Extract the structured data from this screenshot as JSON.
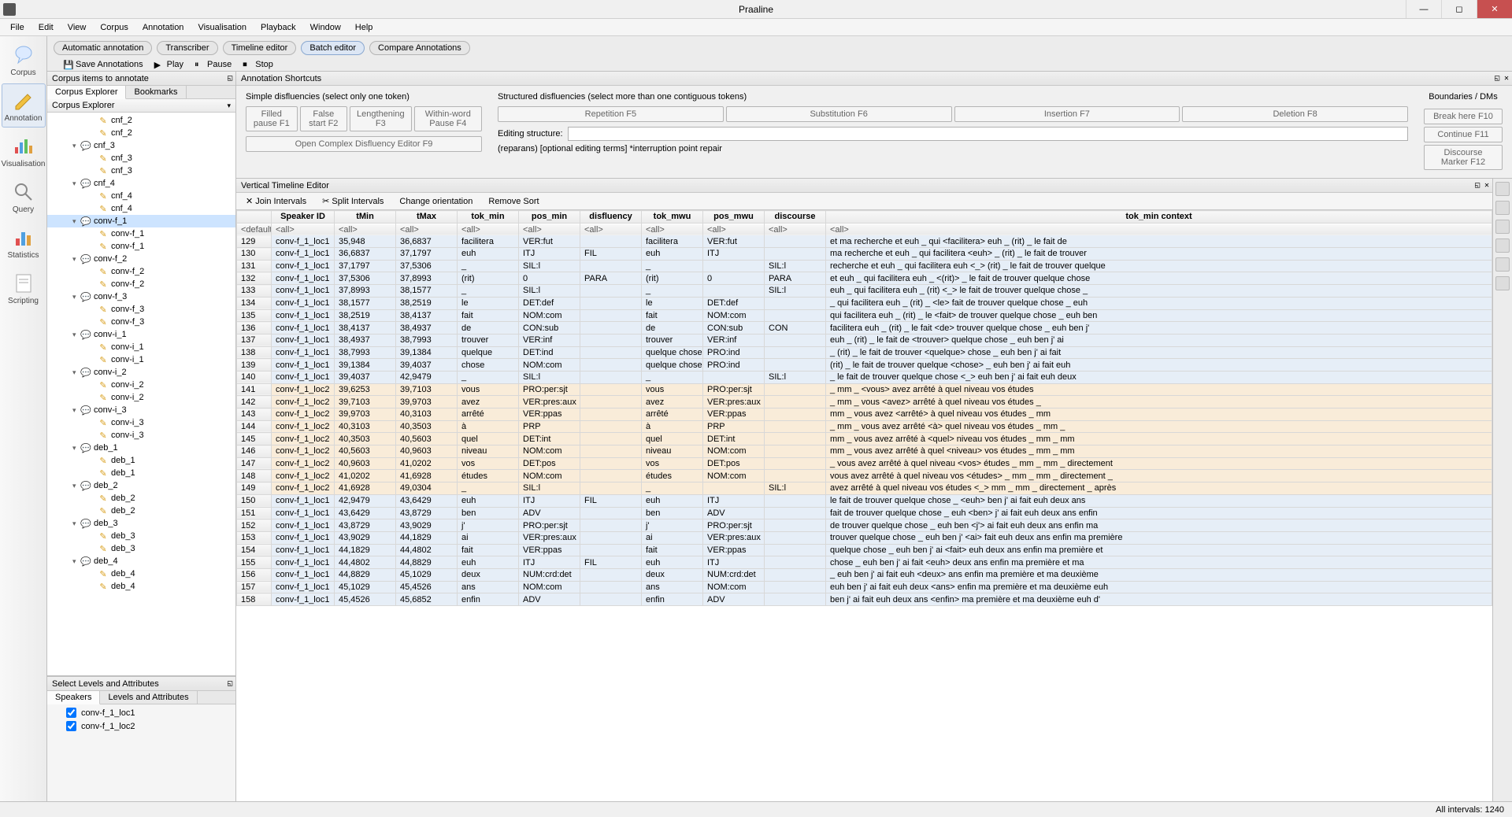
{
  "app": {
    "title": "Praaline"
  },
  "menu": [
    "File",
    "Edit",
    "View",
    "Corpus",
    "Annotation",
    "Visualisation",
    "Playback",
    "Window",
    "Help"
  ],
  "leftnav": [
    {
      "label": "Corpus",
      "icon": "corpus"
    },
    {
      "label": "Annotation",
      "icon": "annotation",
      "selected": true
    },
    {
      "label": "Visualisation",
      "icon": "vis"
    },
    {
      "label": "Query",
      "icon": "query"
    },
    {
      "label": "Statistics",
      "icon": "stats"
    },
    {
      "label": "Scripting",
      "icon": "script"
    }
  ],
  "pills": [
    {
      "label": "Automatic annotation"
    },
    {
      "label": "Transcriber"
    },
    {
      "label": "Timeline editor"
    },
    {
      "label": "Batch editor",
      "active": true
    },
    {
      "label": "Compare Annotations"
    }
  ],
  "actions": {
    "save": "Save Annotations",
    "play": "Play",
    "pause": "Pause",
    "stop": "Stop"
  },
  "corpus_panel": {
    "title": "Corpus items to annotate",
    "tabs": [
      "Corpus Explorer",
      "Bookmarks"
    ],
    "header": "Corpus Explorer",
    "items": [
      {
        "d": 2,
        "i": "pen",
        "t": "cnf_2"
      },
      {
        "d": 2,
        "i": "pen",
        "t": "cnf_2"
      },
      {
        "d": 1,
        "i": "bub",
        "t": "cnf_3",
        "exp": true
      },
      {
        "d": 2,
        "i": "pen",
        "t": "cnf_3"
      },
      {
        "d": 2,
        "i": "pen",
        "t": "cnf_3"
      },
      {
        "d": 1,
        "i": "bub",
        "t": "cnf_4",
        "exp": true
      },
      {
        "d": 2,
        "i": "pen",
        "t": "cnf_4"
      },
      {
        "d": 2,
        "i": "pen",
        "t": "cnf_4"
      },
      {
        "d": 1,
        "i": "bub",
        "t": "conv-f_1",
        "exp": true,
        "sel": true
      },
      {
        "d": 2,
        "i": "pen",
        "t": "conv-f_1"
      },
      {
        "d": 2,
        "i": "pen",
        "t": "conv-f_1"
      },
      {
        "d": 1,
        "i": "bub",
        "t": "conv-f_2",
        "exp": true
      },
      {
        "d": 2,
        "i": "pen",
        "t": "conv-f_2"
      },
      {
        "d": 2,
        "i": "pen",
        "t": "conv-f_2"
      },
      {
        "d": 1,
        "i": "bub",
        "t": "conv-f_3",
        "exp": true
      },
      {
        "d": 2,
        "i": "pen",
        "t": "conv-f_3"
      },
      {
        "d": 2,
        "i": "pen",
        "t": "conv-f_3"
      },
      {
        "d": 1,
        "i": "bub",
        "t": "conv-i_1",
        "exp": true
      },
      {
        "d": 2,
        "i": "pen",
        "t": "conv-i_1"
      },
      {
        "d": 2,
        "i": "pen",
        "t": "conv-i_1"
      },
      {
        "d": 1,
        "i": "bub",
        "t": "conv-i_2",
        "exp": true
      },
      {
        "d": 2,
        "i": "pen",
        "t": "conv-i_2"
      },
      {
        "d": 2,
        "i": "pen",
        "t": "conv-i_2"
      },
      {
        "d": 1,
        "i": "bub",
        "t": "conv-i_3",
        "exp": true
      },
      {
        "d": 2,
        "i": "pen",
        "t": "conv-i_3"
      },
      {
        "d": 2,
        "i": "pen",
        "t": "conv-i_3"
      },
      {
        "d": 1,
        "i": "bub",
        "t": "deb_1",
        "exp": true
      },
      {
        "d": 2,
        "i": "pen",
        "t": "deb_1"
      },
      {
        "d": 2,
        "i": "pen",
        "t": "deb_1"
      },
      {
        "d": 1,
        "i": "bub",
        "t": "deb_2",
        "exp": true
      },
      {
        "d": 2,
        "i": "pen",
        "t": "deb_2"
      },
      {
        "d": 2,
        "i": "pen",
        "t": "deb_2"
      },
      {
        "d": 1,
        "i": "bub",
        "t": "deb_3",
        "exp": true
      },
      {
        "d": 2,
        "i": "pen",
        "t": "deb_3"
      },
      {
        "d": 2,
        "i": "pen",
        "t": "deb_3"
      },
      {
        "d": 1,
        "i": "bub",
        "t": "deb_4",
        "exp": true
      },
      {
        "d": 2,
        "i": "pen",
        "t": "deb_4"
      },
      {
        "d": 2,
        "i": "pen",
        "t": "deb_4"
      }
    ]
  },
  "levels_panel": {
    "title": "Select Levels and Attributes",
    "tabs": [
      "Speakers",
      "Levels and Attributes"
    ],
    "checks": [
      "conv-f_1_loc1",
      "conv-f_1_loc2"
    ]
  },
  "shortcuts": {
    "title": "Annotation Shortcuts",
    "simple_label": "Simple disfluencies (select only one token)",
    "simple": [
      "Filled pause F1",
      "False start F2",
      "Lengthening F3",
      "Within-word Pause F4"
    ],
    "complex": "Open Complex Disfluency Editor F9",
    "struct_label": "Structured disfluencies (select more than one contiguous tokens)",
    "struct": [
      "Repetition F5",
      "Substitution F6",
      "Insertion F7",
      "Deletion F8"
    ],
    "edit_label": "Editing structure:",
    "expl": "(reparans) [optional editing terms] *interruption point repair",
    "right_label": "Boundaries / DMs",
    "right": [
      "Break here F10",
      "Continue F11",
      "Discourse Marker F12"
    ]
  },
  "vte": {
    "title": "Vertical Timeline Editor",
    "toolbar": {
      "join": "Join Intervals",
      "split": "Split Intervals",
      "orient": "Change orientation",
      "remove": "Remove Sort"
    },
    "columns": [
      "",
      "Speaker ID",
      "tMin",
      "tMax",
      "tok_min",
      "pos_min",
      "disfluency",
      "tok_mwu",
      "pos_mwu",
      "discourse",
      "tok_min context"
    ],
    "filters": [
      "<default>",
      "<all>",
      "<all>",
      "<all>",
      "<all>",
      "<all>",
      "<all>",
      "<all>",
      "<all>",
      "<all>",
      "<all>"
    ],
    "rows": [
      [
        "129",
        "conv-f_1_loc1",
        "35,948",
        "36,6837",
        "facilitera",
        "VER:fut",
        "",
        "facilitera",
        "VER:fut",
        "",
        "et ma recherche et euh _ qui <facilitera> euh _ (rit) _ le fait de"
      ],
      [
        "130",
        "conv-f_1_loc1",
        "36,6837",
        "37,1797",
        "euh",
        "ITJ",
        "FIL",
        "euh",
        "ITJ",
        "",
        "ma recherche et euh _ qui facilitera <euh> _ (rit) _ le fait de trouver"
      ],
      [
        "131",
        "conv-f_1_loc1",
        "37,1797",
        "37,5306",
        "_",
        "SIL:l",
        "",
        "_",
        "",
        "SIL:l",
        "recherche et euh _ qui facilitera euh <_> (rit) _ le fait de trouver quelque"
      ],
      [
        "132",
        "conv-f_1_loc1",
        "37,5306",
        "37,8993",
        "(rit)",
        "0",
        "PARA",
        "(rit)",
        "0",
        "PARA",
        "et euh _ qui facilitera euh _ <(rit)> _ le fait de trouver quelque chose"
      ],
      [
        "133",
        "conv-f_1_loc1",
        "37,8993",
        "38,1577",
        "_",
        "SIL:l",
        "",
        "_",
        "",
        "SIL:l",
        "euh _ qui facilitera euh _ (rit) <_> le fait de trouver quelque chose _"
      ],
      [
        "134",
        "conv-f_1_loc1",
        "38,1577",
        "38,2519",
        "le",
        "DET:def",
        "",
        "le",
        "DET:def",
        "",
        "_ qui facilitera euh _ (rit) _ <le> fait de trouver quelque chose _ euh"
      ],
      [
        "135",
        "conv-f_1_loc1",
        "38,2519",
        "38,4137",
        "fait",
        "NOM:com",
        "",
        "fait",
        "NOM:com",
        "",
        "qui facilitera euh _ (rit) _ le <fait> de trouver quelque chose _ euh ben"
      ],
      [
        "136",
        "conv-f_1_loc1",
        "38,4137",
        "38,4937",
        "de",
        "CON:sub",
        "",
        "de",
        "CON:sub",
        "CON",
        "facilitera euh _ (rit) _ le fait <de> trouver quelque chose _ euh ben j'"
      ],
      [
        "137",
        "conv-f_1_loc1",
        "38,4937",
        "38,7993",
        "trouver",
        "VER:inf",
        "",
        "trouver",
        "VER:inf",
        "",
        "euh _ (rit) _ le fait de <trouver> quelque chose _ euh ben j' ai"
      ],
      [
        "138",
        "conv-f_1_loc1",
        "38,7993",
        "39,1384",
        "quelque",
        "DET:ind",
        "",
        "quelque chose",
        "PRO:ind",
        "",
        "_ (rit) _ le fait de trouver <quelque> chose _ euh ben j' ai fait"
      ],
      [
        "139",
        "conv-f_1_loc1",
        "39,1384",
        "39,4037",
        "chose",
        "NOM:com",
        "",
        "quelque chose",
        "PRO:ind",
        "",
        "(rit) _ le fait de trouver quelque <chose> _ euh ben j' ai fait euh"
      ],
      [
        "140",
        "conv-f_1_loc1",
        "39,4037",
        "42,9479",
        "_",
        "SIL:l",
        "",
        "_",
        "",
        "SIL:l",
        "_ le fait de trouver quelque chose <_> euh ben j' ai fait euh deux"
      ],
      [
        "141",
        "conv-f_1_loc2",
        "39,6253",
        "39,7103",
        "vous",
        "PRO:per:sjt",
        "",
        "vous",
        "PRO:per:sjt",
        "",
        "_ mm _ <vous> avez arrêté à quel niveau vos études"
      ],
      [
        "142",
        "conv-f_1_loc2",
        "39,7103",
        "39,9703",
        "avez",
        "VER:pres:aux",
        "",
        "avez",
        "VER:pres:aux",
        "",
        "_ mm _ vous <avez> arrêté à quel niveau vos études _"
      ],
      [
        "143",
        "conv-f_1_loc2",
        "39,9703",
        "40,3103",
        "arrêté",
        "VER:ppas",
        "",
        "arrêté",
        "VER:ppas",
        "",
        "mm _ vous avez <arrêté> à quel niveau vos études _ mm"
      ],
      [
        "144",
        "conv-f_1_loc2",
        "40,3103",
        "40,3503",
        "à",
        "PRP",
        "",
        "à",
        "PRP",
        "",
        "_ mm _ vous avez arrêté <à> quel niveau vos études _ mm _"
      ],
      [
        "145",
        "conv-f_1_loc2",
        "40,3503",
        "40,5603",
        "quel",
        "DET:int",
        "",
        "quel",
        "DET:int",
        "",
        "mm _ vous avez arrêté à <quel> niveau vos études _ mm _ mm"
      ],
      [
        "146",
        "conv-f_1_loc2",
        "40,5603",
        "40,9603",
        "niveau",
        "NOM:com",
        "",
        "niveau",
        "NOM:com",
        "",
        "mm _ vous avez arrêté à quel <niveau> vos études _ mm _ mm"
      ],
      [
        "147",
        "conv-f_1_loc2",
        "40,9603",
        "41,0202",
        "vos",
        "DET:pos",
        "",
        "vos",
        "DET:pos",
        "",
        "_ vous avez arrêté à quel niveau <vos> études _ mm _ mm _ directement"
      ],
      [
        "148",
        "conv-f_1_loc2",
        "41,0202",
        "41,6928",
        "études",
        "NOM:com",
        "",
        "études",
        "NOM:com",
        "",
        "vous avez arrêté à quel niveau vos <études> _ mm _ mm _ directement _"
      ],
      [
        "149",
        "conv-f_1_loc2",
        "41,6928",
        "49,0304",
        "_",
        "SIL:l",
        "",
        "_",
        "",
        "SIL:l",
        "avez arrêté à quel niveau vos études <_> mm _ mm _ directement _ après"
      ],
      [
        "150",
        "conv-f_1_loc1",
        "42,9479",
        "43,6429",
        "euh",
        "ITJ",
        "FIL",
        "euh",
        "ITJ",
        "",
        "le fait de trouver quelque chose _ <euh> ben j' ai fait euh deux ans"
      ],
      [
        "151",
        "conv-f_1_loc1",
        "43,6429",
        "43,8729",
        "ben",
        "ADV",
        "",
        "ben",
        "ADV",
        "",
        "fait de trouver quelque chose _ euh <ben> j' ai fait euh deux ans enfin"
      ],
      [
        "152",
        "conv-f_1_loc1",
        "43,8729",
        "43,9029",
        "j'",
        "PRO:per:sjt",
        "",
        "j'",
        "PRO:per:sjt",
        "",
        "de trouver quelque chose _ euh ben <j'> ai fait euh deux ans enfin ma"
      ],
      [
        "153",
        "conv-f_1_loc1",
        "43,9029",
        "44,1829",
        "ai",
        "VER:pres:aux",
        "",
        "ai",
        "VER:pres:aux",
        "",
        "trouver quelque chose _ euh ben j' <ai> fait euh deux ans enfin ma première"
      ],
      [
        "154",
        "conv-f_1_loc1",
        "44,1829",
        "44,4802",
        "fait",
        "VER:ppas",
        "",
        "fait",
        "VER:ppas",
        "",
        "quelque chose _ euh ben j' ai <fait> euh deux ans enfin ma première et"
      ],
      [
        "155",
        "conv-f_1_loc1",
        "44,4802",
        "44,8829",
        "euh",
        "ITJ",
        "FIL",
        "euh",
        "ITJ",
        "",
        "chose _ euh ben j' ai fait <euh> deux ans enfin ma première et ma"
      ],
      [
        "156",
        "conv-f_1_loc1",
        "44,8829",
        "45,1029",
        "deux",
        "NUM:crd:det",
        "",
        "deux",
        "NUM:crd:det",
        "",
        "_ euh ben j' ai fait euh <deux> ans enfin ma première et ma deuxième"
      ],
      [
        "157",
        "conv-f_1_loc1",
        "45,1029",
        "45,4526",
        "ans",
        "NOM:com",
        "",
        "ans",
        "NOM:com",
        "",
        "euh ben j' ai fait euh deux <ans> enfin ma première et ma deuxième euh"
      ],
      [
        "158",
        "conv-f_1_loc1",
        "45,4526",
        "45,6852",
        "enfin",
        "ADV",
        "",
        "enfin",
        "ADV",
        "",
        "ben j' ai fait euh deux ans <enfin> ma première et ma deuxième euh d'"
      ]
    ]
  },
  "status": {
    "intervals": "All intervals: 1240"
  }
}
